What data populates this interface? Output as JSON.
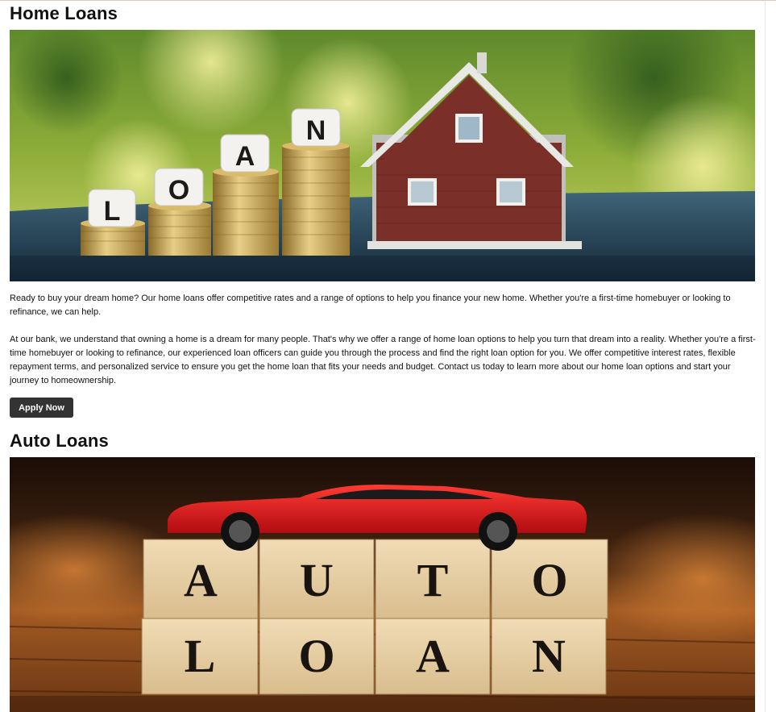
{
  "home": {
    "title": "Home Loans",
    "image_blocks": [
      "L",
      "O",
      "A",
      "N"
    ],
    "intro": "Ready to buy your dream home? Our home loans offer competitive rates and a range of options to help you finance your new home. Whether you're a first-time homebuyer or looking to refinance, we can help.",
    "details": "At our bank, we understand that owning a home is a dream for many people. That's why we offer a range of home loan options to help you turn that dream into a reality. Whether you're a first-time homebuyer or looking to refinance, our experienced loan officers can guide you through the process and find the right loan option for you. We offer competitive interest rates, flexible repayment terms, and personalized service to ensure you get the home loan that fits your needs and budget. Contact us today to learn more about our home loan options and start your journey to homeownership.",
    "apply_label": "Apply Now"
  },
  "auto": {
    "title": "Auto Loans",
    "image_blocks_row1": [
      "A",
      "U",
      "T",
      "O"
    ],
    "image_blocks_row2": [
      "L",
      "O",
      "A",
      "N"
    ]
  },
  "colors": {
    "button_bg": "#333333",
    "button_text": "#ffffff",
    "car_red": "#d8161b"
  }
}
